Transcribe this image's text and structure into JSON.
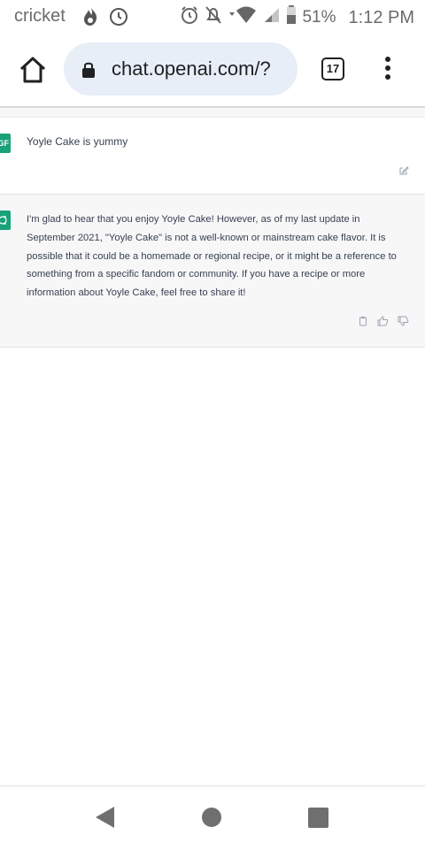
{
  "status_bar": {
    "carrier": "cricket",
    "battery_percent": "51%",
    "time": "1:12 PM"
  },
  "browser": {
    "url": "chat.openai.com/?",
    "tab_count": "17"
  },
  "chat": {
    "user_avatar_initials": "GF",
    "user_message": "Yoyle Cake is yummy",
    "assistant_message": "I'm glad to hear that you enjoy Yoyle Cake! However, as of my last update in September 2021, \"Yoyle Cake\" is not a well-known or mainstream cake flavor. It is possible that it could be a homemade or regional recipe, or it might be a reference to something from a specific fandom or community. If you have a recipe or more information about Yoyle Cake, feel free to share it!"
  },
  "colors": {
    "accent": "#19a17a",
    "assistant_bg": "#f7f7f8",
    "url_pill": "#e8eef7"
  }
}
